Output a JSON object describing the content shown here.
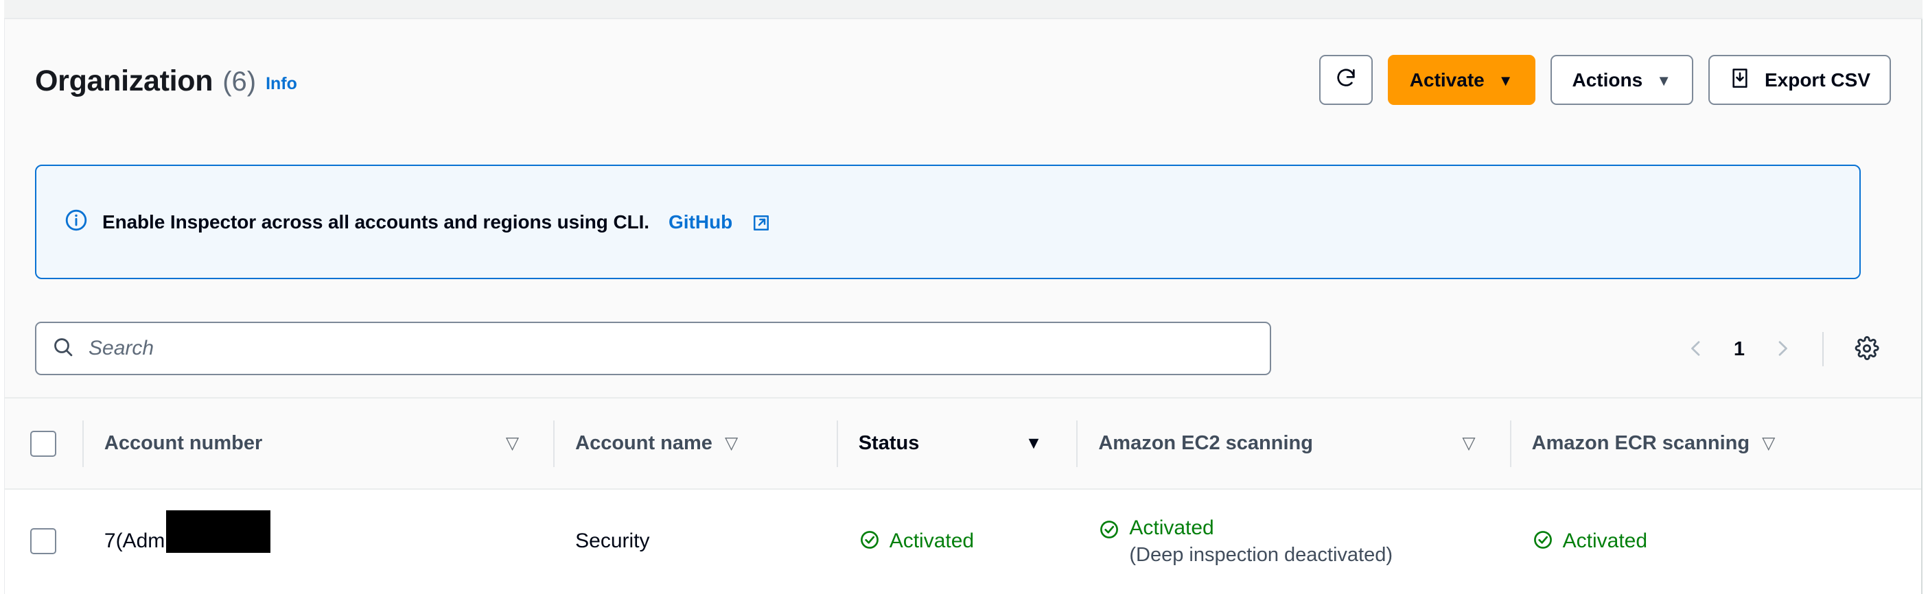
{
  "page": {
    "title": "Organization",
    "count": "(6)",
    "info_link": "Info"
  },
  "toolbar": {
    "refresh_icon": "refresh-icon",
    "activate_label": "Activate",
    "activate_caret": "▼",
    "actions_label": "Actions",
    "actions_caret": "▼",
    "export_label": "Export CSV",
    "export_icon": "download-csv-icon",
    "activate_color": "#ff9900"
  },
  "banner": {
    "icon": "info-circle-icon",
    "text": "Enable Inspector across all accounts and regions using CLI.",
    "link_label": "GitHub",
    "link_external_icon": "external-link-icon",
    "border_color": "#0972d3",
    "background_color": "#f2f8fd"
  },
  "search": {
    "icon": "search-icon",
    "placeholder": "Search",
    "value": ""
  },
  "pagination": {
    "prev_icon": "chevron-left-icon",
    "page": "1",
    "next_icon": "chevron-right-icon",
    "settings_icon": "gear-icon"
  },
  "table": {
    "select_all_name": "select-all-checkbox",
    "columns": [
      {
        "label": "Account number",
        "sort_glyph": "▽",
        "sorted": false
      },
      {
        "label": "Account name",
        "sort_glyph": "▽",
        "sorted": false
      },
      {
        "label": "Status",
        "sort_glyph": "▼",
        "sorted": true
      },
      {
        "label": "Amazon EC2 scanning",
        "sort_glyph": "▽",
        "sorted": false
      },
      {
        "label": "Amazon ECR scanning",
        "sort_glyph": "▽",
        "sorted": false
      }
    ],
    "rows": [
      {
        "account_number_prefix": "7",
        "account_number_redacted": true,
        "account_role": "(Administrator)",
        "account_name": "Security",
        "status": "Activated",
        "status_icon": "status-success-icon",
        "ec2_scanning": "Activated",
        "ec2_scanning_note": "(Deep inspection deactivated)",
        "ec2_icon": "status-success-icon",
        "ecr_scanning": "Activated",
        "ecr_icon": "status-success-icon"
      }
    ]
  },
  "colors": {
    "success": "#037f0c",
    "link": "#0972d3",
    "accent": "#ff9900"
  }
}
